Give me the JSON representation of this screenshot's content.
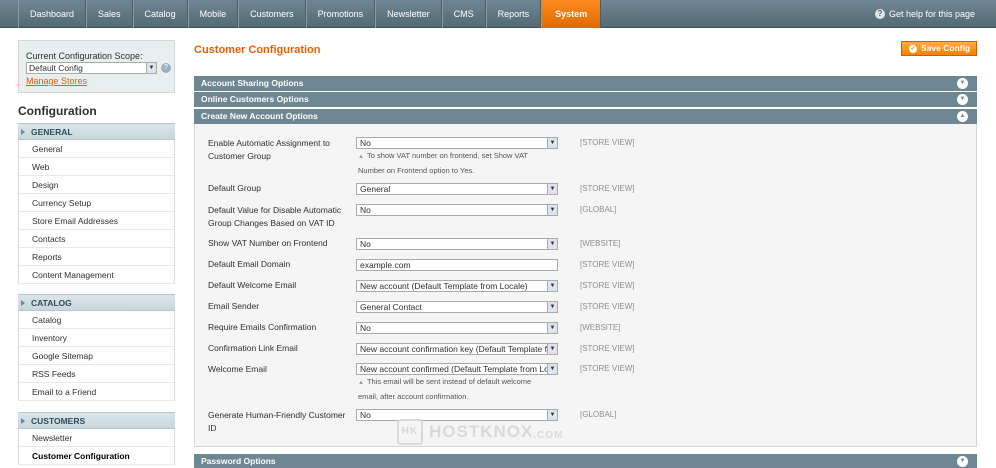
{
  "nav": {
    "items": [
      "Dashboard",
      "Sales",
      "Catalog",
      "Mobile",
      "Customers",
      "Promotions",
      "Newsletter",
      "CMS",
      "Reports",
      "System"
    ],
    "active": "System",
    "help": "Get help for this page"
  },
  "sidebar": {
    "scope_label": "Current Configuration Scope:",
    "scope_value": "Default Config",
    "manage_stores": "Manage Stores",
    "title": "Configuration",
    "sections": [
      {
        "header": "GENERAL",
        "items": [
          "General",
          "Web",
          "Design",
          "Currency Setup",
          "Store Email Addresses",
          "Contacts",
          "Reports",
          "Content Management"
        ]
      },
      {
        "header": "CATALOG",
        "items": [
          "Catalog",
          "Inventory",
          "Google Sitemap",
          "RSS Feeds",
          "Email to a Friend"
        ]
      },
      {
        "header": "CUSTOMERS",
        "items": [
          "Newsletter",
          "Customer Configuration"
        ]
      }
    ]
  },
  "main": {
    "title": "Customer Configuration",
    "save_label": "Save Config",
    "sections": {
      "account_sharing": "Account Sharing Options",
      "online_customers": "Online Customers Options",
      "create_account": "Create New Account Options",
      "password": "Password Options"
    },
    "rows": [
      {
        "label": "Enable Automatic Assignment to Customer Group",
        "value": "No",
        "scope": "[STORE VIEW]",
        "note": "To show VAT number on frontend, set Show VAT Number on Frontend option to Yes."
      },
      {
        "label": "Default Group",
        "value": "General",
        "scope": "[STORE VIEW]"
      },
      {
        "label": "Default Value for Disable Automatic Group Changes Based on VAT ID",
        "value": "No",
        "scope": "[GLOBAL]"
      },
      {
        "label": "Show VAT Number on Frontend",
        "value": "No",
        "scope": "[WEBSITE]"
      },
      {
        "label": "Default Email Domain",
        "value": "example.com",
        "scope": "[STORE VIEW]"
      },
      {
        "label": "Default Welcome Email",
        "value": "New account (Default Template from Locale)",
        "scope": "[STORE VIEW]"
      },
      {
        "label": "Email Sender",
        "value": "General Contact",
        "scope": "[STORE VIEW]"
      },
      {
        "label": "Require Emails Confirmation",
        "value": "No",
        "scope": "[WEBSITE]"
      },
      {
        "label": "Confirmation Link Email",
        "value": "New account confirmation key (Default Template fr",
        "scope": "[STORE VIEW]"
      },
      {
        "label": "Welcome Email",
        "value": "New account confirmed (Default Template from Lo",
        "scope": "[STORE VIEW]",
        "note": "This email will be sent instead of default welcome email, after account confirmation."
      },
      {
        "label": "Generate Human-Friendly Customer ID",
        "value": "No",
        "scope": "[GLOBAL]"
      }
    ]
  },
  "watermark": {
    "logo": "HK",
    "text": "HOSTKNOX",
    "suffix": ".COM"
  }
}
